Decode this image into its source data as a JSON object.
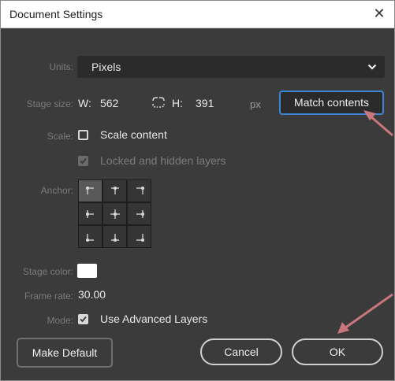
{
  "window": {
    "title": "Document Settings",
    "close_glyph": "✕"
  },
  "units": {
    "label": "Units:",
    "value": "Pixels"
  },
  "stage_size": {
    "label": "Stage size:",
    "w_label": "W:",
    "w_value": "562",
    "h_label": "H:",
    "h_value": "391",
    "unit": "px",
    "link_icon": "chain-link-icon"
  },
  "match_button": {
    "label": "Match contents"
  },
  "scale": {
    "label": "Scale:",
    "checkbox_label": "Scale content",
    "checked": false
  },
  "locked": {
    "checkbox_label": "Locked and hidden layers",
    "checked": true,
    "disabled": true
  },
  "anchor": {
    "label": "Anchor:",
    "selected": "top-left"
  },
  "stage_color": {
    "label": "Stage color:",
    "value": "#ffffff"
  },
  "frame_rate": {
    "label": "Frame rate:",
    "value": "30.00"
  },
  "mode": {
    "label": "Mode:",
    "checkbox_label": "Use Advanced Layers",
    "checked": true
  },
  "buttons": {
    "make_default": "Make Default",
    "cancel": "Cancel",
    "ok": "OK"
  },
  "colors": {
    "dialog_bg": "#3b3b3b",
    "accent": "#3b86d6",
    "annotation_arrow": "#c9767c"
  }
}
